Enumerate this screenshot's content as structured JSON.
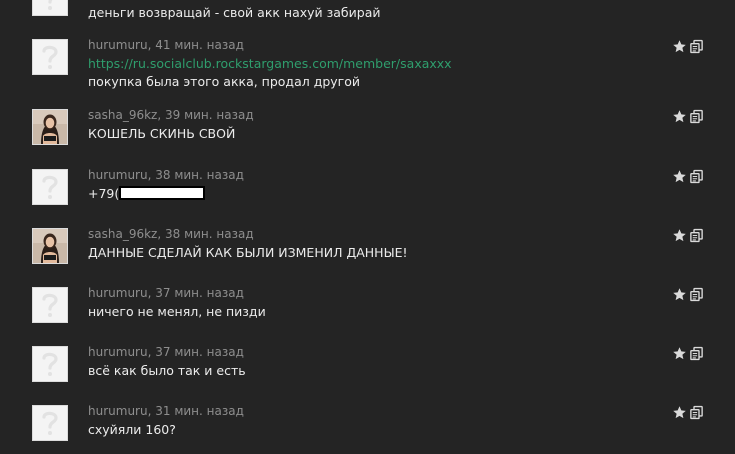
{
  "messages": [
    {
      "avatar": "default-avatar",
      "text": "деньги возвращай - свой акк нахуй забирай"
    },
    {
      "avatar": "default-avatar",
      "author": "hurumuru",
      "time": "41 мин. назад",
      "link": "https://ru.socialclub.rockstargames.com/member/saxaxxx",
      "text": "покупка была этого акка, продал другой"
    },
    {
      "avatar": "photo-avatar",
      "author": "sasha_96kz",
      "time": "39 мин. назад",
      "text": "КОШЕЛЬ СКИНЬ СВОЙ"
    },
    {
      "avatar": "default-avatar",
      "author": "hurumuru",
      "time": "38 мин. назад",
      "text": "+79(",
      "redacted": true
    },
    {
      "avatar": "photo-avatar",
      "author": "sasha_96kz",
      "time": "38 мин. назад",
      "text": "ДАННЫЕ СДЕЛАЙ КАК БЫЛИ ИЗМЕНИЛ ДАННЫЕ!"
    },
    {
      "avatar": "default-avatar",
      "author": "hurumuru",
      "time": "37 мин. назад",
      "text": "ничего не менял, не пизди"
    },
    {
      "avatar": "default-avatar",
      "author": "hurumuru",
      "time": "37 мин. назад",
      "text": "всё как было так и есть"
    },
    {
      "avatar": "default-avatar",
      "author": "hurumuru",
      "time": "31 мин. назад",
      "text": "схуйяли 160?"
    }
  ],
  "meta_separator": ", ",
  "actions": {
    "star_icon": "star-icon",
    "copy_icon": "copy-icon"
  },
  "colors": {
    "background": "#242424",
    "meta": "#8e8e8e",
    "text": "#ececec",
    "link": "#2f9e6d"
  }
}
